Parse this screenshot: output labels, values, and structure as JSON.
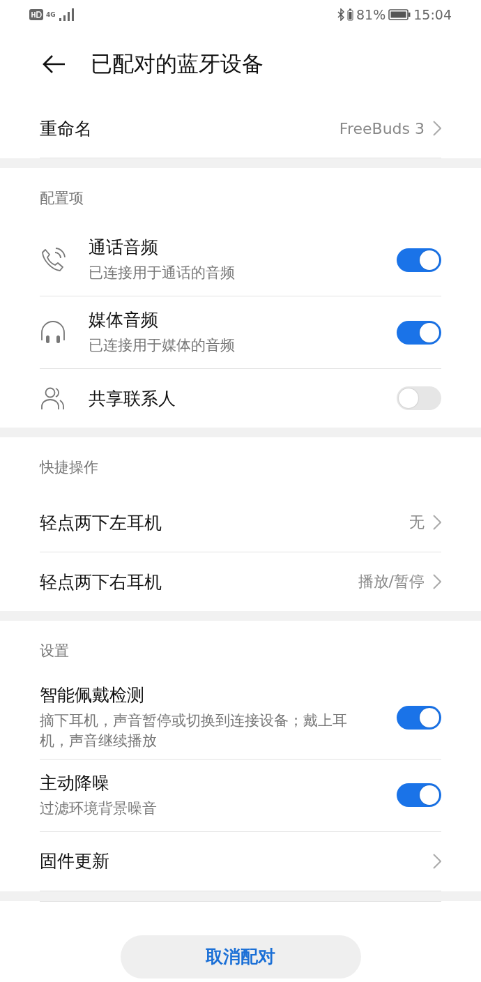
{
  "status_bar": {
    "network": "4G",
    "battery_percent": "81%",
    "time": "15:04"
  },
  "header": {
    "title": "已配对的蓝牙设备"
  },
  "rename": {
    "label": "重命名",
    "value": "FreeBuds 3"
  },
  "sections": [
    {
      "title": "配置项",
      "items": [
        {
          "kind": "toggle",
          "title": "通话音频",
          "subtitle": "已连接用于通话的音频",
          "on": true
        },
        {
          "kind": "toggle",
          "title": "媒体音频",
          "subtitle": "已连接用于媒体的音频",
          "on": true
        },
        {
          "kind": "toggle",
          "title": "共享联系人",
          "on": false
        }
      ]
    },
    {
      "title": "快捷操作",
      "items": [
        {
          "kind": "link",
          "title": "轻点两下左耳机",
          "value": "无"
        },
        {
          "kind": "link",
          "title": "轻点两下右耳机",
          "value": "播放/暂停"
        }
      ]
    },
    {
      "title": "设置",
      "items": [
        {
          "kind": "toggle",
          "title": "智能佩戴检测",
          "subtitle": "摘下耳机，声音暂停或切换到连接设备；戴上耳机，声音继续播放",
          "on": true
        },
        {
          "kind": "toggle",
          "title": "主动降噪",
          "subtitle": "过滤环境背景噪音",
          "on": true
        },
        {
          "kind": "link",
          "title": "固件更新"
        }
      ]
    }
  ],
  "unpair_button": "取消配对"
}
